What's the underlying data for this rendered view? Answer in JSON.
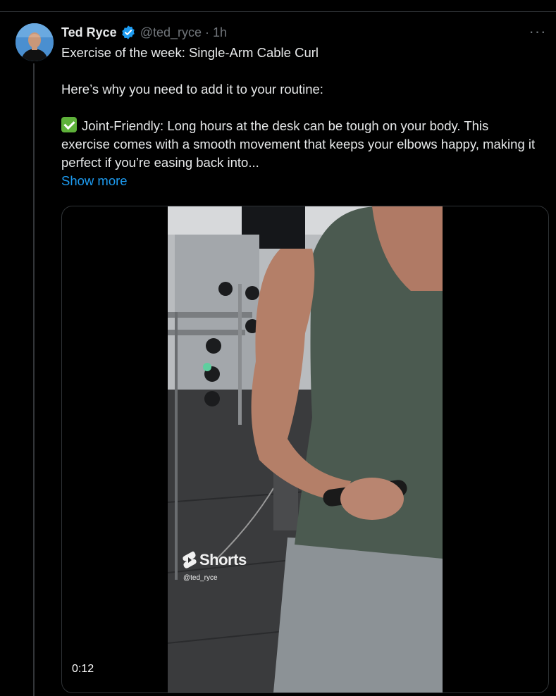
{
  "tweet": {
    "author": {
      "display_name": "Ted Ryce",
      "verified_icon": "verified-badge-icon",
      "handle": "@ted_ryce",
      "separator": "·",
      "time": "1h"
    },
    "more_icon": "more-icon",
    "more_glyph": "···",
    "text": {
      "line1": "Exercise of the week: Single-Arm Cable Curl",
      "line2": "Here’s why you need to add it to your routine:",
      "line3": "Joint-Friendly: Long hours at the desk can be tough on your body. This exercise comes with a smooth movement that keeps your elbows happy, making it perfect if you’re easing back into..."
    },
    "show_more_label": "Show more",
    "media": {
      "type": "video",
      "watermark_label": "Shorts",
      "watermark_handle": "@ted_ryce",
      "duration": "0:12"
    }
  },
  "colors": {
    "background": "#000000",
    "text_primary": "#e7e9ea",
    "text_secondary": "#71767b",
    "accent": "#1d9bf0",
    "divider": "#2f3336"
  }
}
